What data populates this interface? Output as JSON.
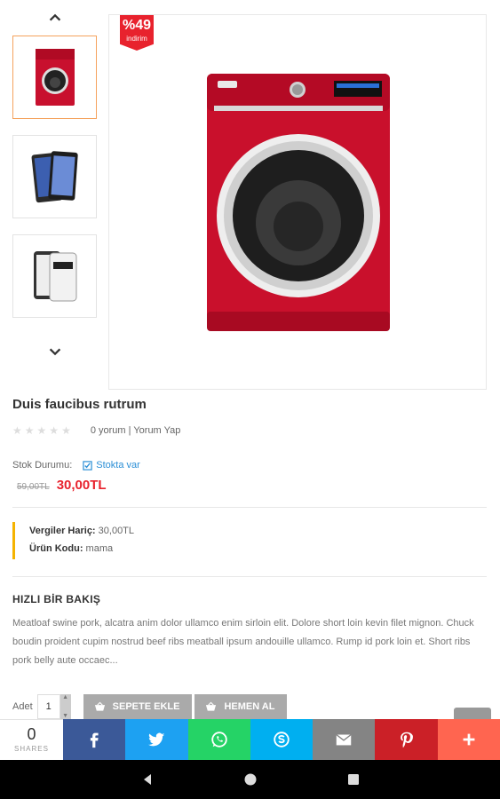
{
  "gallery": {
    "sale_badge": {
      "percent": "%49",
      "label": "indirim"
    }
  },
  "product": {
    "title": "Duis faucibus rutrum",
    "reviews_text": "0 yorum | Yorum Yap",
    "stock_label": "Stok Durumu:",
    "stock_value": "Stokta var",
    "old_price": "59,00TL",
    "new_price": "30,00TL",
    "tax_label": "Vergiler Hariç:",
    "tax_value": "30,00TL",
    "code_label": "Ürün Kodu:",
    "code_value": "mama"
  },
  "quick_view": {
    "title": "HIZLI BİR BAKIŞ",
    "text": "Meatloaf swine pork, alcatra anim dolor ullamco enim sirloin elit. Dolore short loin kevin filet mignon. Chuck boudin proident cupim nostrud beef ribs meatball ipsum andouille ullamco. Rump id pork loin et. Short ribs pork belly aute occaec..."
  },
  "purchase": {
    "qty_label": "Adet",
    "qty_value": "1",
    "add_to_cart": "SEPETE EKLE",
    "buy_now": "HEMEN AL"
  },
  "share": {
    "count": "0",
    "count_label": "SHARES",
    "colors": {
      "facebook": "#3b5998",
      "twitter": "#1da1f2",
      "whatsapp": "#25d366",
      "skype": "#00aff0",
      "email": "#848484",
      "pinterest": "#cb2027",
      "more": "#ff6550"
    }
  }
}
